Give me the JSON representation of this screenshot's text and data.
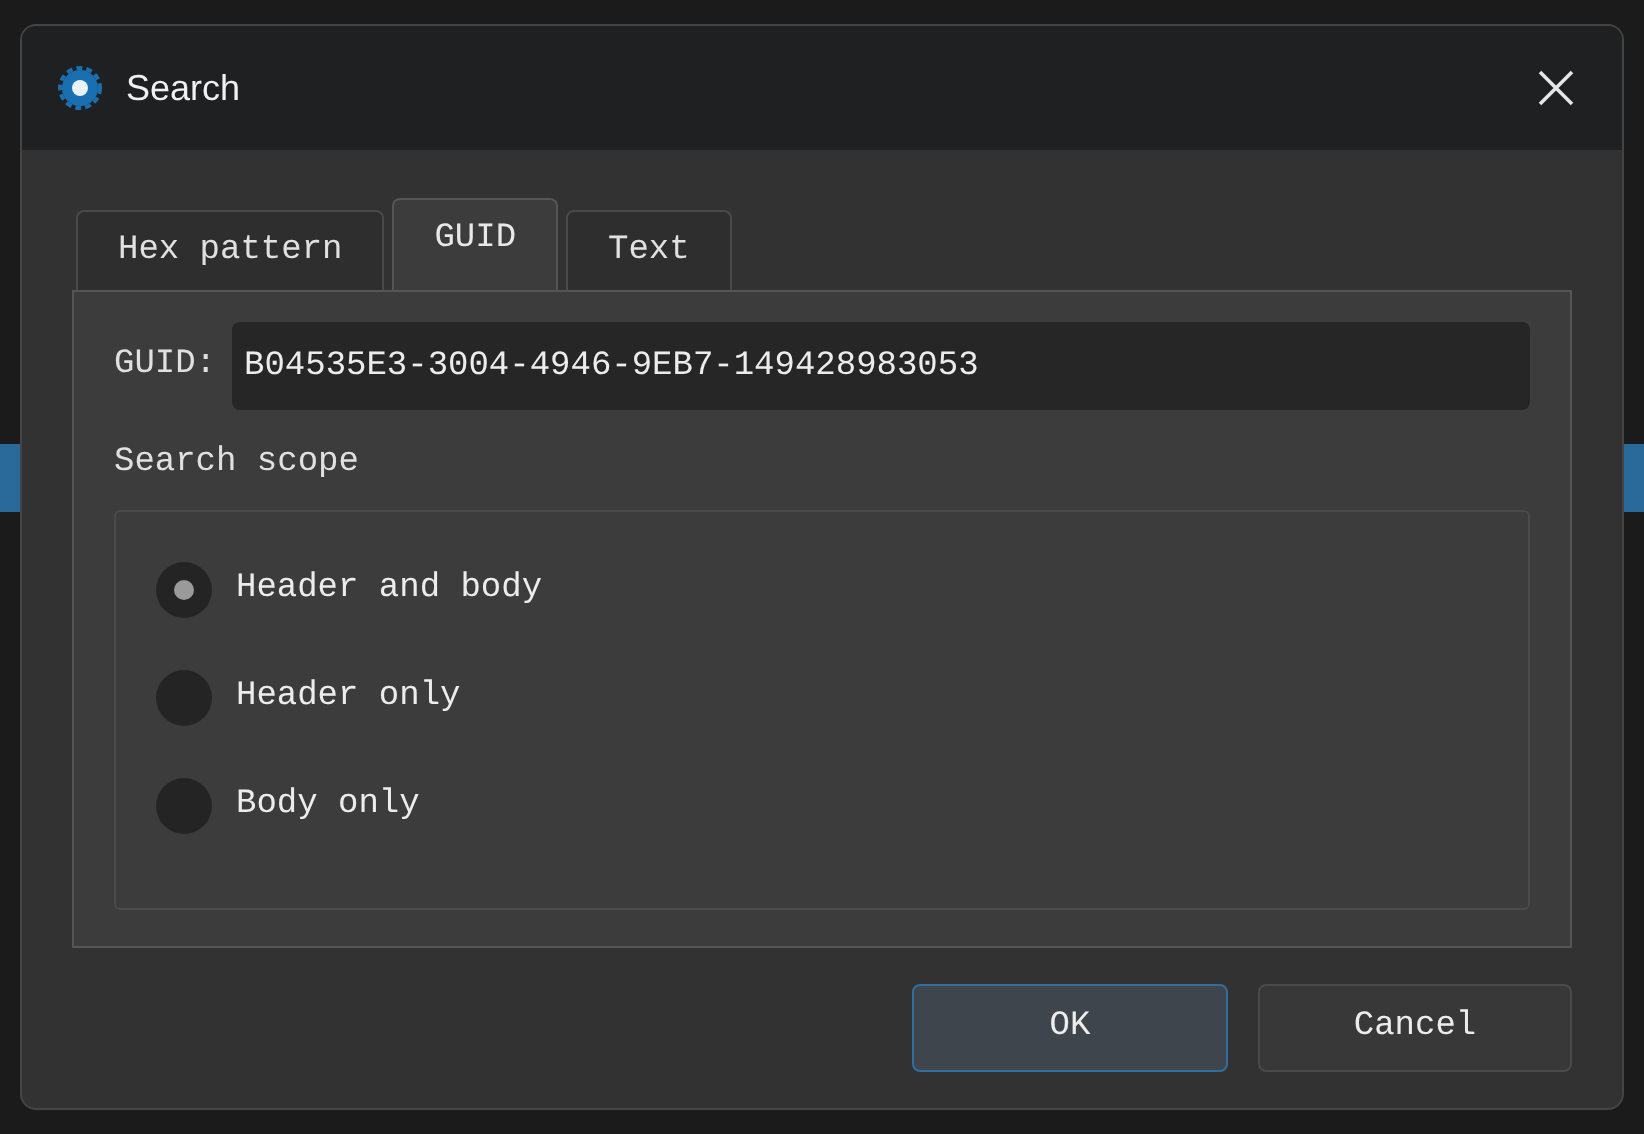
{
  "window": {
    "title": "Search"
  },
  "tabs": [
    {
      "label": "Hex pattern",
      "selected": false
    },
    {
      "label": "GUID",
      "selected": true
    },
    {
      "label": "Text",
      "selected": false
    }
  ],
  "guid_field": {
    "label": "GUID:",
    "value": "B04535E3-3004-4946-9EB7-149428983053"
  },
  "search_scope": {
    "title": "Search scope",
    "options": [
      {
        "label": "Header and body",
        "selected": true
      },
      {
        "label": "Header only",
        "selected": false
      },
      {
        "label": "Body only",
        "selected": false
      }
    ]
  },
  "buttons": [
    {
      "label": "OK",
      "kind": "default"
    },
    {
      "label": "Cancel",
      "kind": "normal"
    }
  ]
}
